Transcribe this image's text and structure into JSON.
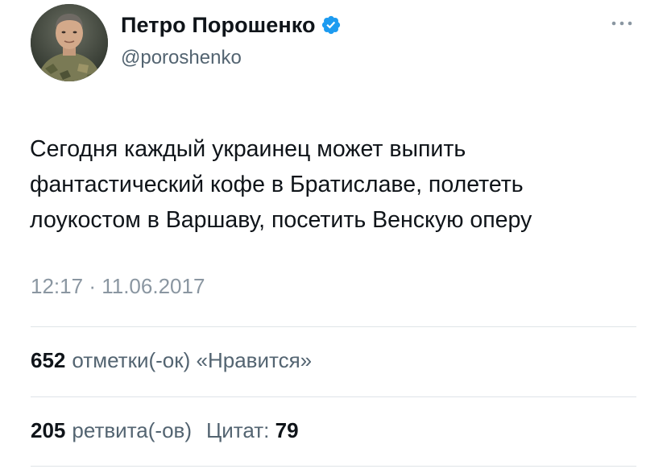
{
  "author": {
    "display_name": "Петро Порошенко",
    "handle": "@poroshenko",
    "verified": true,
    "avatar_icon": "profile-photo"
  },
  "menu": {
    "icon": "more-icon"
  },
  "tweet": {
    "lines": [
      "Сегодня каждый украинец может выпить",
      "фантастический кофе в Братиславе, полететь",
      "лоукостом в Варшаву, посетить Венскую оперу"
    ],
    "time": "12:17",
    "separator": "·",
    "date": "11.06.2017"
  },
  "stats": {
    "likes_count": "652",
    "likes_label": "отметки(-ок) «Нравится»",
    "retweets_count": "205",
    "retweets_label": "ретвита(-ов)",
    "quotes_label": "Цитат:",
    "quotes_count": "79"
  },
  "colors": {
    "text": "#0f1419",
    "secondary": "#536471",
    "timestamp": "#8a96a1",
    "verified": "#1d9bf0",
    "divider": "#dfe4e8"
  }
}
